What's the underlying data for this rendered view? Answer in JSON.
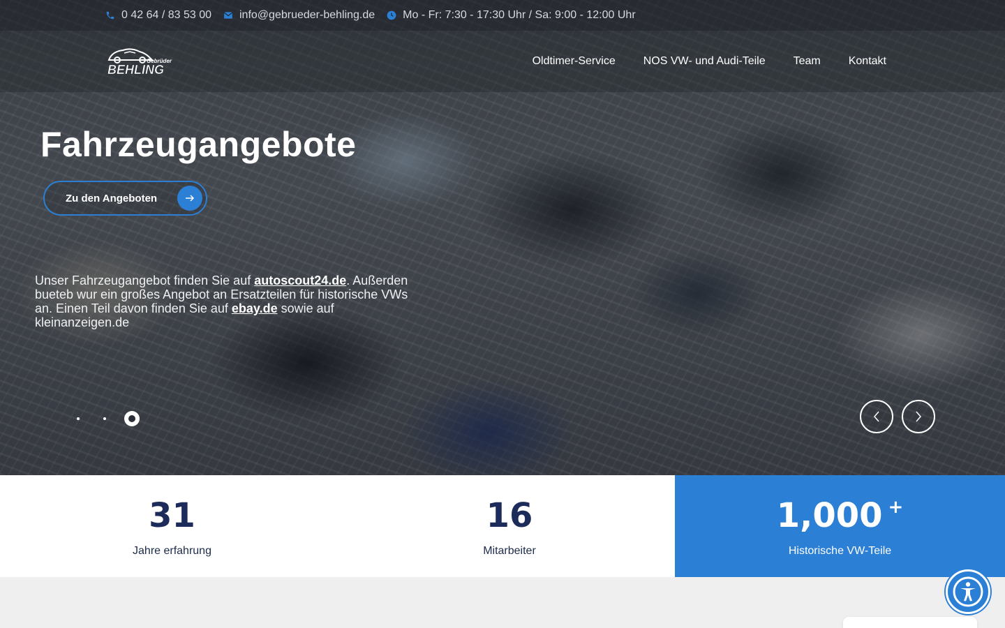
{
  "topbar": {
    "phone": "0 42 64 / 83 53 00",
    "email": "info@gebrueder-behling.de",
    "hours": "Mo - Fr: 7:30 - 17:30 Uhr / Sa: 9:00 - 12:00 Uhr",
    "phone_icon": "phone-icon",
    "email_icon": "envelope-icon",
    "hours_icon": "clock-icon"
  },
  "logo": {
    "top_text": "Gebrüder",
    "main_text": "BEHLING"
  },
  "nav": {
    "items": [
      {
        "label": "Oldtimer-Service"
      },
      {
        "label": "NOS VW- und Audi-Teile"
      },
      {
        "label": "Team"
      },
      {
        "label": "Kontakt"
      }
    ]
  },
  "hero": {
    "title": "Fahrzeugangebote",
    "cta_label": "Zu den Angeboten",
    "cta_icon": "arrow-right-icon",
    "text_part1": "Unser Fahrzeugangebot finden Sie auf ",
    "link1": "autoscout24.de",
    "text_part2": ". Außerden bueteb wur ein großes Angebot an Ersatzteilen für historische VWs an. Einen Teil davon finden Sie auf ",
    "link2": "ebay.de",
    "text_part3": " sowie auf kleinanzeigen.de",
    "slides_total": 3,
    "active_slide": 3
  },
  "stats": [
    {
      "value": "31",
      "label": "Jahre erfahrung"
    },
    {
      "value": "16",
      "label": "Mitarbeiter"
    },
    {
      "value": "1,000",
      "suffix": "+",
      "label": "Historische VW-Teile"
    }
  ],
  "colors": {
    "accent": "#2b7fd4",
    "stat_number": "#1c2b5a",
    "page_bg": "#efefef"
  }
}
